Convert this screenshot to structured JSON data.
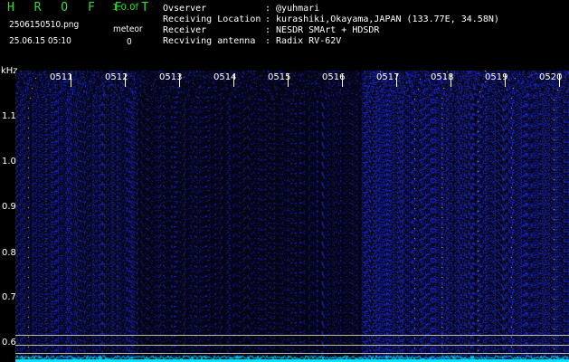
{
  "header": {
    "app_title": "H R O F F T",
    "version": "1.0.0f",
    "filename": "2506150510.png",
    "datetime": "25.06.15 05:10",
    "meteor_label": "meteor",
    "meteor_count": "0"
  },
  "station_info": [
    {
      "key": "Ovserver",
      "value": ": @yuhmari"
    },
    {
      "key": "Receiving Location",
      "value": ": kurashiki,Okayama,JAPAN (133.77E, 34.58N)"
    },
    {
      "key": "Receiver",
      "value": ": NESDR SMArt + HDSDR"
    },
    {
      "key": "Recviving antenna",
      "value": ": Radix RV-62V"
    }
  ],
  "spectrogram": {
    "y_unit": "kHz",
    "y_ticks": [
      "1.1",
      "1.0",
      "0.9",
      "0.8",
      "0.7",
      "0.6"
    ],
    "x_ticks": [
      "0511",
      "0512",
      "0513",
      "0514",
      "0515",
      "0516",
      "0517",
      "0518",
      "0519",
      "0520"
    ],
    "colors": {
      "background": "#050616",
      "noise": "#2a35c8",
      "signal": "#00e5ff",
      "reference_line": "#ddddaa"
    }
  }
}
